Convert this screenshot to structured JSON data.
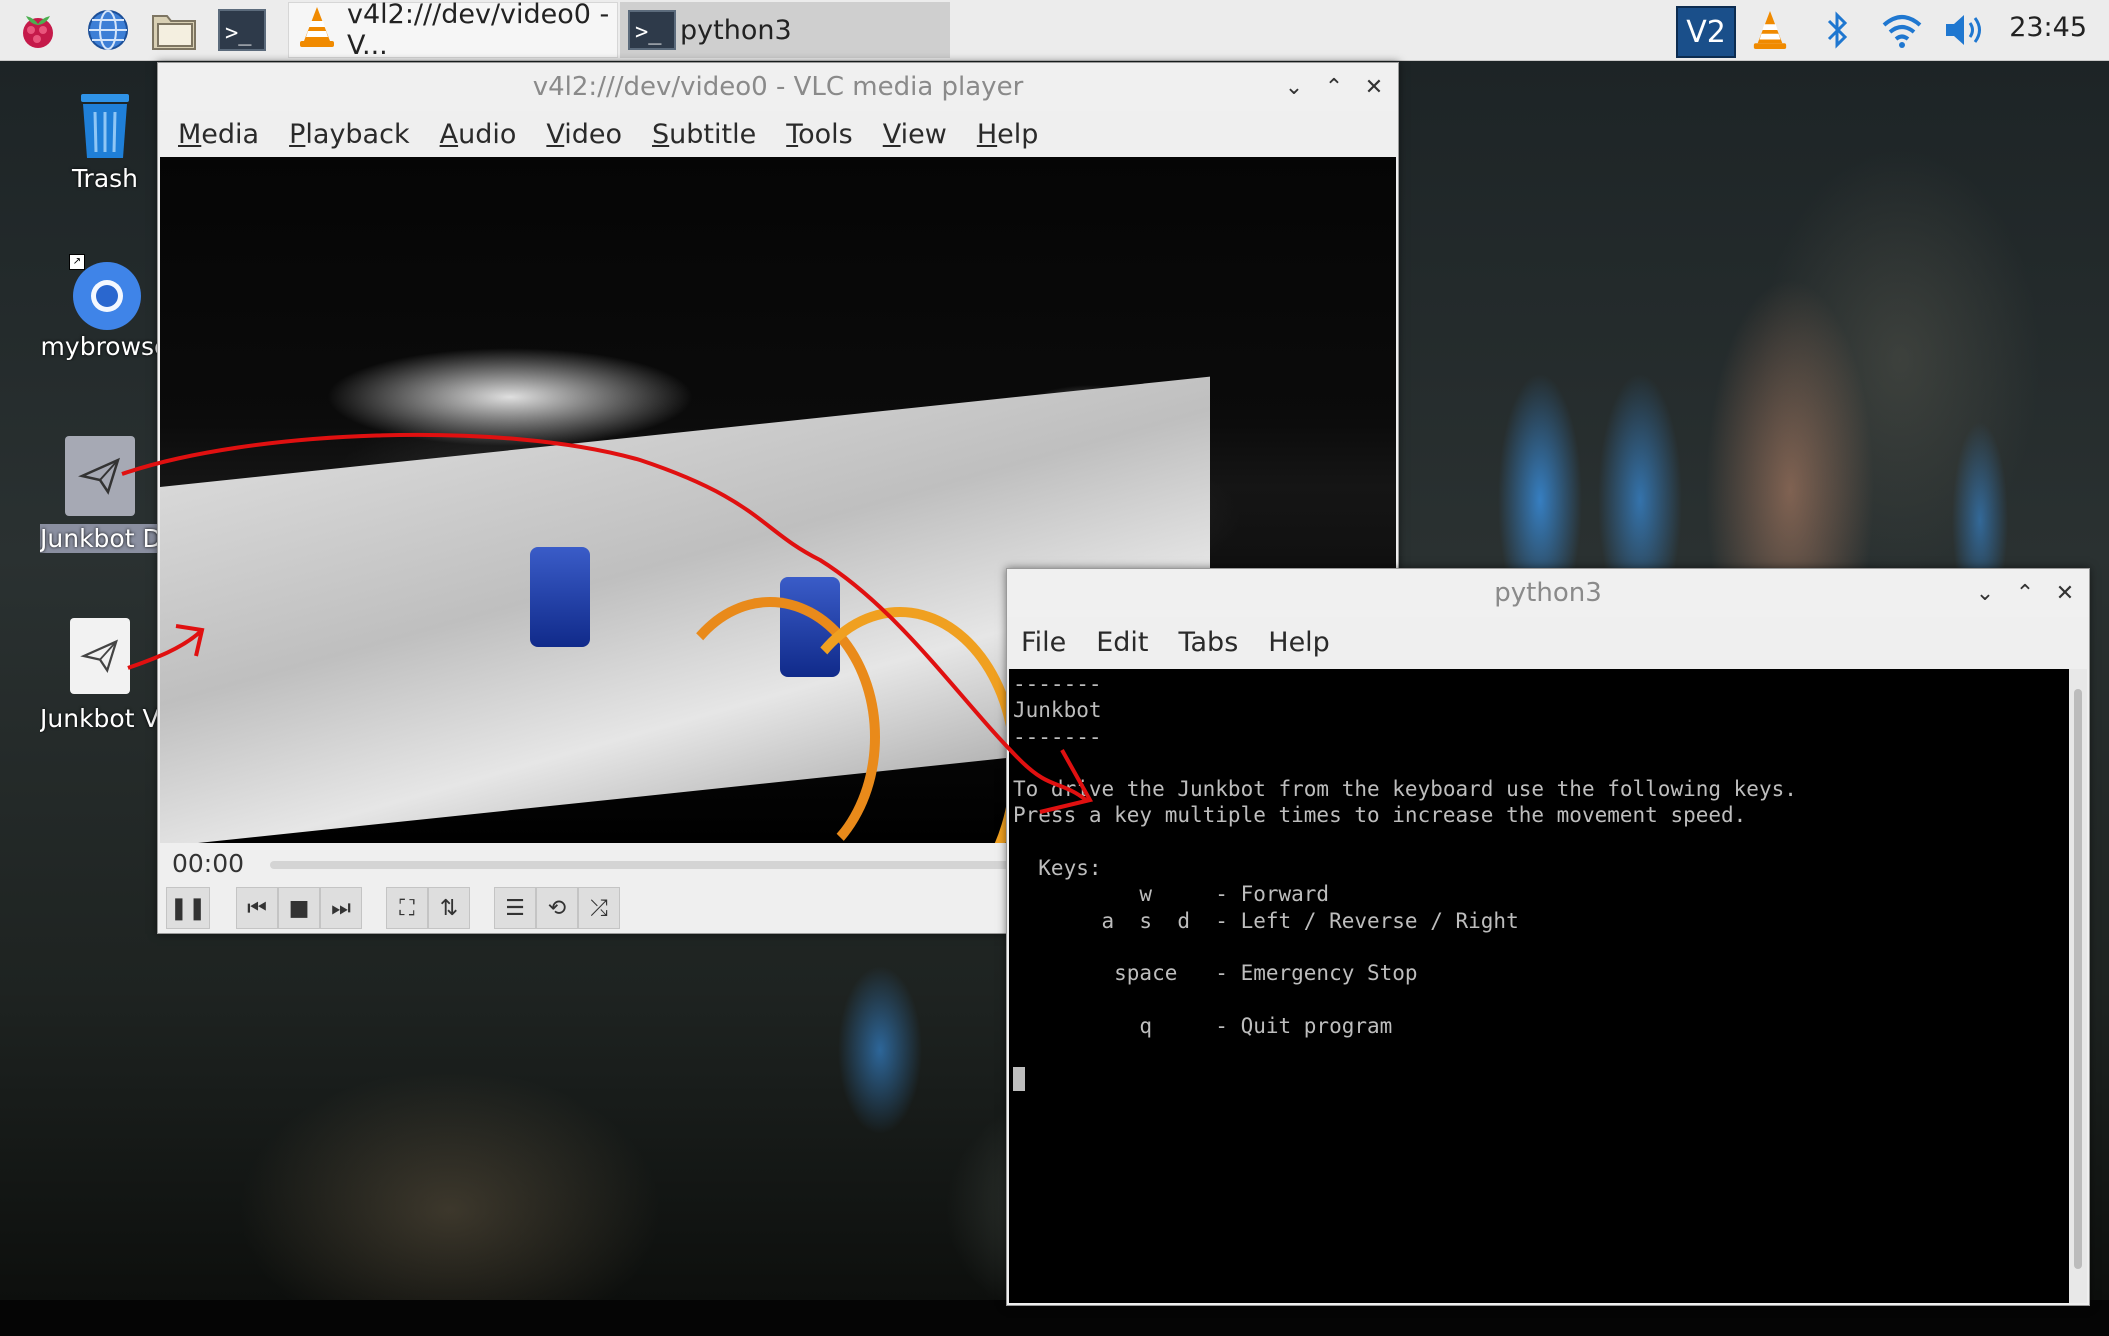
{
  "taskbar": {
    "tasks": [
      {
        "label": "v4l2:///dev/video0 - V...",
        "icon": "vlc-cone-icon"
      },
      {
        "label": "python3",
        "icon": "terminal-icon"
      }
    ],
    "clock": "23:45"
  },
  "desktop": {
    "icons": [
      {
        "label": "Trash",
        "icon": "trash-icon"
      },
      {
        "label": "mybrowse",
        "icon": "chromium-icon"
      },
      {
        "label": "Junkbot Dri",
        "icon": "send-icon"
      },
      {
        "label": "Junkbot Vi",
        "icon": "send-icon"
      }
    ]
  },
  "vlc": {
    "title": "v4l2:///dev/video0 - VLC media player",
    "menu": [
      "Media",
      "Playback",
      "Audio",
      "Video",
      "Subtitle",
      "Tools",
      "View",
      "Help"
    ],
    "time": "00:00"
  },
  "terminal": {
    "title": "python3",
    "menu": [
      "File",
      "Edit",
      "Tabs",
      "Help"
    ],
    "lines": [
      "-------",
      "Junkbot",
      "-------",
      "",
      "To drive the Junkbot from the keyboard use the following keys.",
      "Press a key multiple times to increase the movement speed.",
      "",
      "  Keys:",
      "          w     - Forward",
      "       a  s  d  - Left / Reverse / Right",
      "",
      "        space   - Emergency Stop",
      "",
      "          q     - Quit program",
      ""
    ]
  },
  "colors": {
    "annotation": "#e01010",
    "taskbar_bg": "#ececec",
    "terminal_bg": "#000000",
    "terminal_fg": "#bdbdbd"
  }
}
